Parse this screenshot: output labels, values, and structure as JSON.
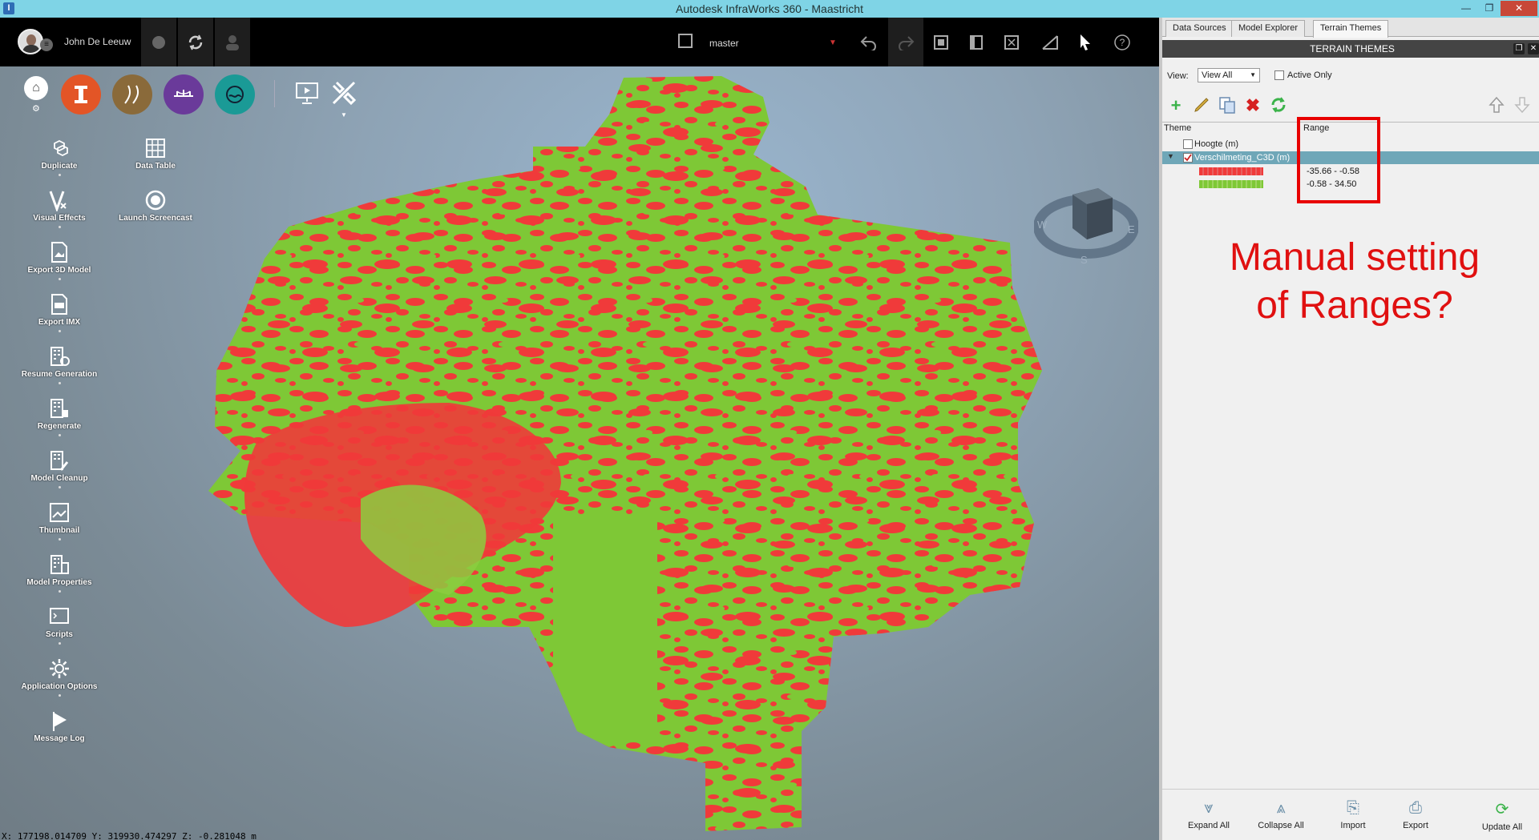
{
  "window": {
    "title": "Autodesk InfraWorks 360 - Maastricht",
    "app_icon_letter": "I",
    "minimize_glyph": "—",
    "restore_glyph": "❐",
    "close_glyph": "✕"
  },
  "topbar": {
    "username": "John De Leeuw",
    "branch": "master"
  },
  "modes": [
    {
      "name": "home",
      "color": "#ffffff"
    },
    {
      "name": "infrastructure",
      "color": "#e35526"
    },
    {
      "name": "roads",
      "color": "#8a6a3a"
    },
    {
      "name": "bridges",
      "color": "#6a3a9a"
    },
    {
      "name": "drainage",
      "color": "#1a9a96"
    }
  ],
  "tools": {
    "duplicate": "Duplicate",
    "data_table": "Data Table",
    "visual_effects": "Visual Effects",
    "launch_screencast": "Launch Screencast",
    "export_3d_model": "Export 3D Model",
    "export_imx": "Export IMX",
    "resume_generation": "Resume Generation",
    "regenerate": "Regenerate",
    "model_cleanup": "Model Cleanup",
    "thumbnail": "Thumbnail",
    "model_properties": "Model Properties",
    "scripts": "Scripts",
    "application_options": "Application Options",
    "message_log": "Message Log"
  },
  "status": {
    "coords": "X: 177198.014709 Y: 319930.474297 Z: -0.281048 m"
  },
  "compass": {
    "w": "W",
    "e": "E",
    "s": "S"
  },
  "panel": {
    "tabs": [
      "Data Sources",
      "Model Explorer",
      "Terrain Themes"
    ],
    "active_tab": "Terrain Themes",
    "header": "TERRAIN THEMES",
    "view_label": "View:",
    "view_value": "View All",
    "active_only_label": "Active Only",
    "col_theme": "Theme",
    "col_range": "Range",
    "themes": [
      {
        "name": "Hoogte (m)",
        "checked": false,
        "selected": false
      },
      {
        "name": "Verschilmeting_C3D (m)",
        "checked": true,
        "selected": true
      }
    ],
    "ranges": [
      {
        "label": "-35.66 - -0.58",
        "color": "#f03a3a"
      },
      {
        "label": "-0.58 - 34.50",
        "color": "#7ec836"
      }
    ],
    "annotation_line1": "Manual setting",
    "annotation_line2": "of Ranges?",
    "bottom": {
      "expand_all": "Expand All",
      "collapse_all": "Collapse All",
      "import": "Import",
      "export": "Export",
      "update_all": "Update All"
    }
  },
  "colors": {
    "terrain_green": "#7ec836",
    "terrain_red": "#f03a3a",
    "annotation_red": "#e01010"
  }
}
